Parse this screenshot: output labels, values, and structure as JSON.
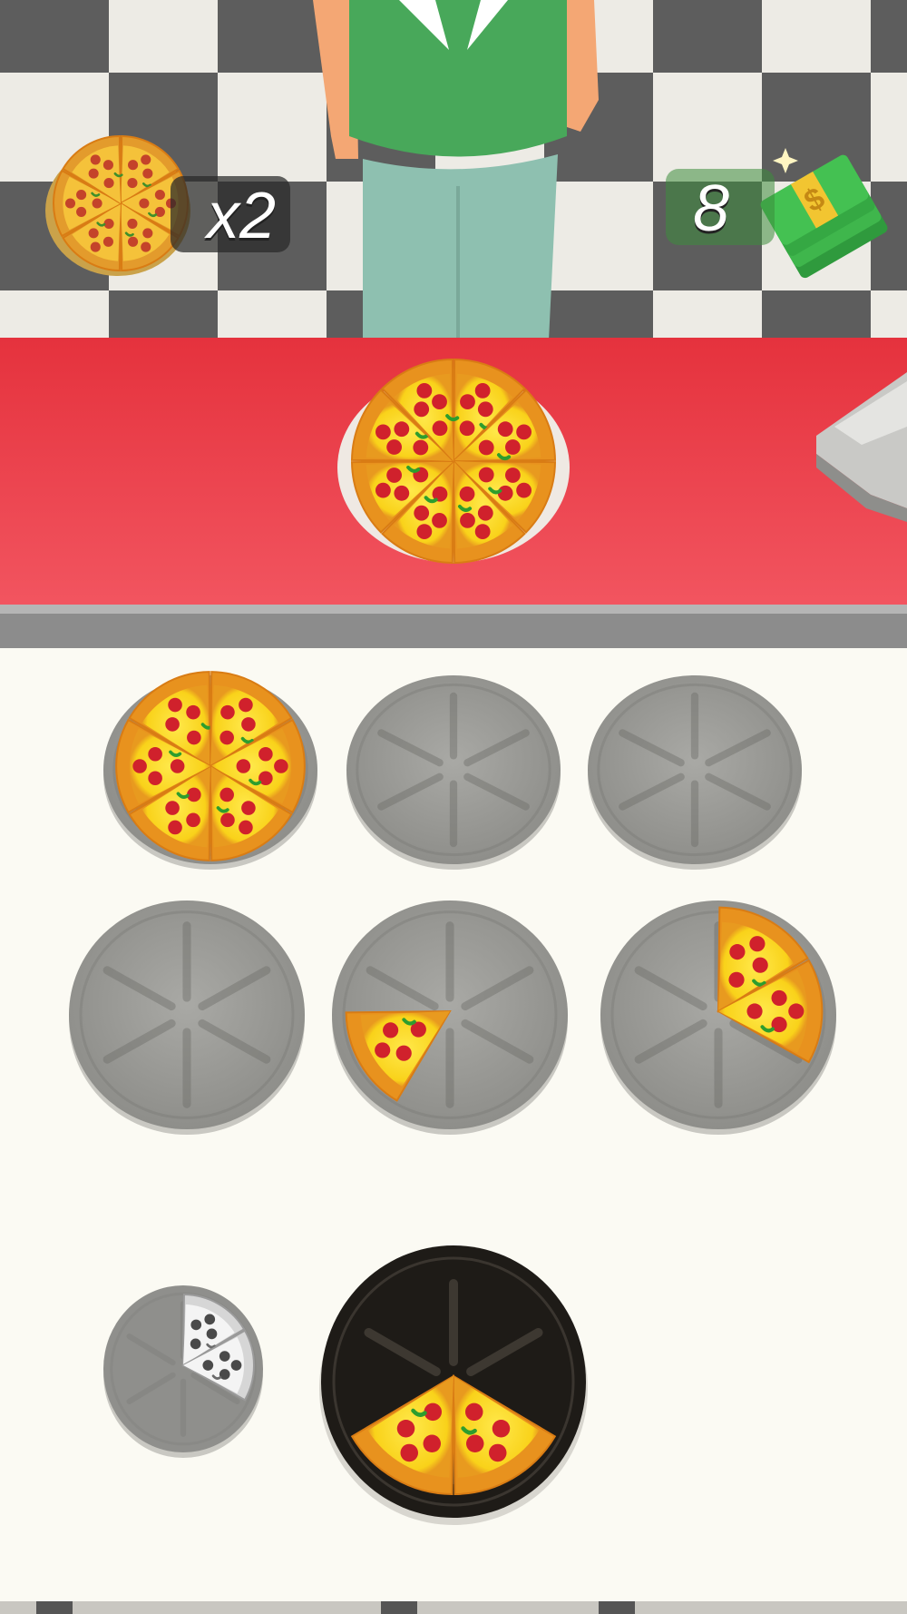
{
  "hud": {
    "pizza_count": "x2",
    "money": "8",
    "pizza_icon": "whole-pizza-icon",
    "money_icon": "cash-stack-icon"
  },
  "counter": {
    "order_pizza_slices": 8,
    "register_icon": "cash-register-icon"
  },
  "board": {
    "rows": [
      [
        {
          "slices": 6,
          "start": "top-left"
        },
        {
          "slices": 0
        },
        {
          "slices": 0
        }
      ],
      [
        {
          "slices": 0
        },
        {
          "slices": 1,
          "start": "bottom-left"
        },
        {
          "slices": 2,
          "start": "top-right"
        }
      ]
    ]
  },
  "tray": {
    "next_plate_slices": 2,
    "next_plate_preview": "grey-outline-slices",
    "active_plate_slices": 2
  },
  "colors": {
    "floor_light": "#e9e7e0",
    "floor_dark": "#3a3a3a",
    "counter_red": "#ea3a45",
    "board_bg": "#fbfaf3",
    "plate_grey": "#a7a7a3",
    "active_plate": "#1e1b17",
    "shirt_green": "#48a85a",
    "pants_blue": "#8ec0b0"
  }
}
